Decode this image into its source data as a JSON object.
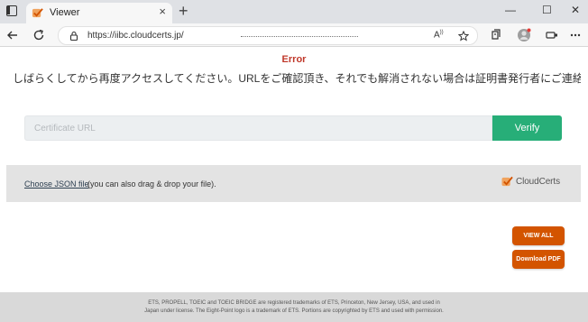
{
  "browser": {
    "tab_title": "Viewer",
    "tab_close": "×",
    "new_tab": "+",
    "url": "https://iibc.cloudcerts.jp/",
    "window_minimize": "—",
    "window_maximize": "☐",
    "window_close": "✕"
  },
  "page": {
    "error_title": "Error",
    "error_message": "しばらくしてから再度アクセスしてください。URLをご確認頂き、それでも解消されない場合は証明書発行者にご連絡ください。"
  },
  "verify": {
    "placeholder": "Certificate URL",
    "button_label": "Verify"
  },
  "drop_zone": {
    "choose_link": "Choose JSON file",
    "hint": "(you can also drag & drop your file).",
    "logo_text": "CloudCerts"
  },
  "actions": {
    "view_all": "VIEW ALL",
    "download_pdf": "Download PDF"
  },
  "footer": {
    "line1": "ETS, PROPELL, TOEIC and TOEIC BRIDGE are registered trademarks of ETS, Princeton, New Jersey, USA, and used in",
    "line2": "Japan under license. The Eight-Point logo is a trademark of ETS. Portions are copyrighted by ETS and used with permission."
  },
  "colors": {
    "error": "#c0392b",
    "verify_button": "#27ae78",
    "action_buttons": "#d35400",
    "drop_zone_bg": "#e3e3e3",
    "footer_bg": "#d9d9d9"
  },
  "icons": [
    "tab-actions-icon",
    "cloudcerts-favicon-icon",
    "back-arrow-icon",
    "refresh-icon",
    "site-info-icon",
    "read-aloud-icon",
    "favorite-star-icon",
    "collections-icon",
    "profile-avatar-icon",
    "extensions-icon",
    "more-menu-icon",
    "cloudcerts-logo-icon"
  ]
}
